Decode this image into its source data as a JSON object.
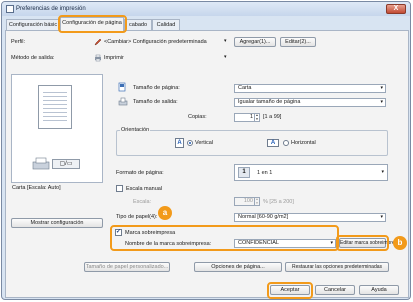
{
  "window": {
    "title": "Preferencias de impresión",
    "close_label": "X"
  },
  "tabs": [
    {
      "label": "Configuración básic"
    },
    {
      "label": "Configuración de página"
    },
    {
      "label": "cabado"
    },
    {
      "label": "Calidad"
    }
  ],
  "profile": {
    "label": "Perfil:",
    "value": "<Cambiar> Configuración predeterminada",
    "add_label": "Agregar(1)...",
    "edit_label": "Editar(2)..."
  },
  "output": {
    "label": "Método de salida:",
    "value": "Imprimir"
  },
  "preview": {
    "caption": "Carta [Escala: Auto]",
    "show_config_label": "Mostrar configuración"
  },
  "page_size": {
    "label": "Tamaño de página:",
    "value": "Carta"
  },
  "output_size": {
    "label": "Tamaño de salida:",
    "value": "Igualar tamaño de página"
  },
  "copies": {
    "label": "Copias:",
    "value": "1",
    "range": "[1 a 99]"
  },
  "orientation": {
    "label": "Orientación",
    "vertical_label": "Vertical",
    "horizontal_label": "Horizontal",
    "glyph": "A"
  },
  "page_format": {
    "label": "Formato de página:",
    "value": "1 en 1",
    "icon_text": "1"
  },
  "scaling": {
    "manual_label": "Escala manual",
    "scale_label": "Escala:",
    "scale_value": "100",
    "scale_range": "% [25 a 200]"
  },
  "paper_type": {
    "label": "Tipo de papel(4):",
    "value": "Normal [60-90 g/m2]"
  },
  "watermark": {
    "check_label": "Marca sobreimpresa",
    "name_label": "Nombre de la marca sobreimpresa:",
    "name_value": "CONFIDENCIAL",
    "edit_label": "Editar marca sobreimpreso..."
  },
  "bottom_buttons": {
    "custom_size": "Tamaño de papel personalizado...",
    "page_options": "Opciones de página...",
    "restore": "Restaurar las opciones predeterminadas"
  },
  "dialog_buttons": {
    "ok": "Aceptar",
    "cancel": "Cancelar",
    "help": "Ayuda"
  },
  "callouts": {
    "a": "a",
    "b": "b"
  },
  "colors": {
    "highlight": "#f29a1a",
    "window_frame": "#d8e4f2"
  }
}
